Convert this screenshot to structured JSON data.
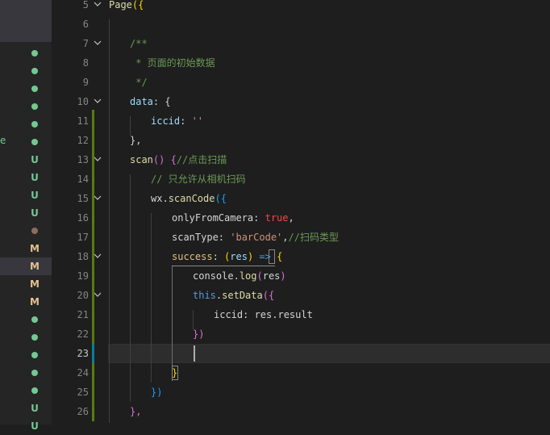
{
  "explorer": {
    "cut_text": "e",
    "status_items": [
      {
        "type": "dot",
        "color": "#73c991"
      },
      {
        "type": "dot",
        "color": "#73c991"
      },
      {
        "type": "dot",
        "color": "#73c991"
      },
      {
        "type": "dot",
        "color": "#73c991"
      },
      {
        "type": "dot",
        "color": "#73c991"
      },
      {
        "type": "dot",
        "color": "#73c991"
      },
      {
        "type": "letter",
        "text": "U",
        "color": "#73c991"
      },
      {
        "type": "letter",
        "text": "U",
        "color": "#73c991"
      },
      {
        "type": "letter",
        "text": "U",
        "color": "#73c991"
      },
      {
        "type": "letter",
        "text": "U",
        "color": "#73c991"
      },
      {
        "type": "dot",
        "color": "#8a6e5a"
      },
      {
        "type": "letter",
        "text": "M",
        "color": "#e2c08d"
      },
      {
        "type": "letter",
        "text": "M",
        "color": "#e2c08d"
      },
      {
        "type": "letter",
        "text": "M",
        "color": "#e2c08d"
      },
      {
        "type": "letter",
        "text": "M",
        "color": "#e2c08d"
      },
      {
        "type": "dot",
        "color": "#73c991"
      },
      {
        "type": "dot",
        "color": "#73c991"
      },
      {
        "type": "dot",
        "color": "#73c991"
      },
      {
        "type": "dot",
        "color": "#73c991"
      },
      {
        "type": "dot",
        "color": "#73c991"
      },
      {
        "type": "letter",
        "text": "U",
        "color": "#73c991"
      },
      {
        "type": "letter",
        "text": "U",
        "color": "#73c991"
      }
    ]
  },
  "editor": {
    "active_line": "23",
    "lines": [
      {
        "num": "5",
        "fold": true
      },
      {
        "num": "6",
        "fold": false
      },
      {
        "num": "7",
        "fold": true
      },
      {
        "num": "8",
        "fold": false
      },
      {
        "num": "9",
        "fold": false
      },
      {
        "num": "10",
        "fold": true
      },
      {
        "num": "11",
        "fold": false
      },
      {
        "num": "12",
        "fold": false
      },
      {
        "num": "13",
        "fold": true
      },
      {
        "num": "14",
        "fold": false
      },
      {
        "num": "15",
        "fold": true
      },
      {
        "num": "16",
        "fold": false
      },
      {
        "num": "17",
        "fold": false
      },
      {
        "num": "18",
        "fold": true
      },
      {
        "num": "19",
        "fold": false
      },
      {
        "num": "20",
        "fold": true
      },
      {
        "num": "21",
        "fold": false
      },
      {
        "num": "22",
        "fold": false
      },
      {
        "num": "23",
        "fold": false
      },
      {
        "num": "24",
        "fold": false
      },
      {
        "num": "25",
        "fold": false
      },
      {
        "num": "26",
        "fold": false
      }
    ],
    "code": {
      "l5_page": "Page",
      "l5_brace": "({",
      "l7": "/**",
      "l8": " * 页面的初始数据",
      "l9": " */",
      "l10_key": "data",
      "l10_rest": ": {",
      "l11_key": "iccid",
      "l11_colon": ": ",
      "l11_val": "''",
      "l12": "},",
      "l13_fn": "scan",
      "l13_paren": "()",
      "l13_brace": " {",
      "l13_comment": "//点击扫描",
      "l14_comment": "// 只允许从相机扫码",
      "l15_obj": "wx",
      "l15_dot": ".",
      "l15_fn": "scanCode",
      "l15_open": "({",
      "l16_key": "onlyFromCamera",
      "l16_colon": ": ",
      "l16_val": "true",
      "l16_comma": ",",
      "l17_key": "scanType",
      "l17_colon": ": ",
      "l17_val": "'barCode'",
      "l17_comma": ",",
      "l17_comment": "//扫码类型",
      "l18_key": "success",
      "l18_colon": ": ",
      "l18_paren_open": "(",
      "l18_param": "res",
      "l18_paren_close": ")",
      "l18_arrow": " => ",
      "l18_brace": "{",
      "l19_obj": "console",
      "l19_dot": ".",
      "l19_fn": "log",
      "l19_open": "(",
      "l19_arg": "res",
      "l19_close": ")",
      "l20_this": "this",
      "l20_dot": ".",
      "l20_fn": "setData",
      "l20_open": "({",
      "l21_key": "iccid",
      "l21_colon": ": ",
      "l21_val": "res.result",
      "l22": "})",
      "l24": "}",
      "l25": "})",
      "l26": "},"
    }
  }
}
